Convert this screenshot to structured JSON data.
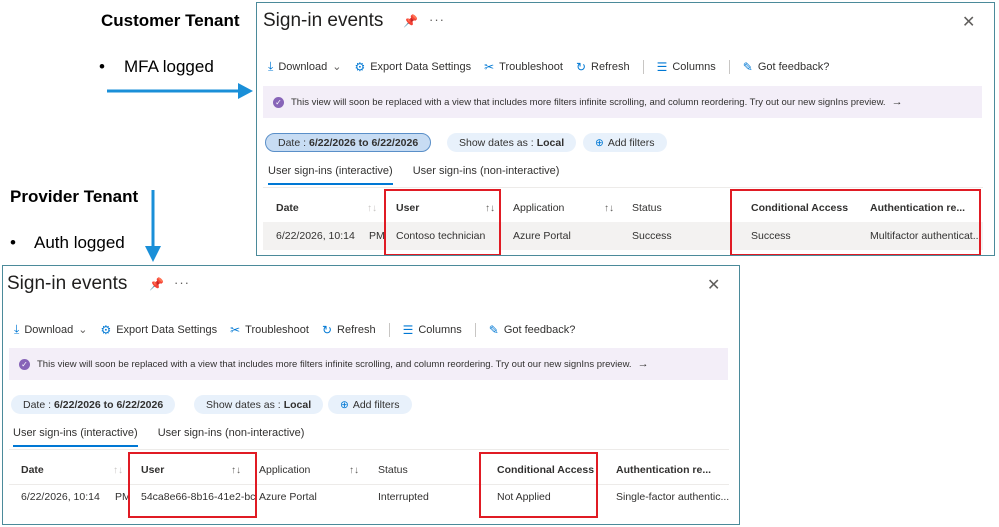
{
  "labels": {
    "customer_tenant": "Customer Tenant",
    "customer_bullet": "MFA logged",
    "provider_tenant": "Provider Tenant",
    "provider_bullet": "Auth logged",
    "bullet_glyph": "•"
  },
  "icons": {
    "pin": "pin-icon",
    "more": "more-icon",
    "close": "close-icon",
    "download": "download-icon",
    "export": "gear-icon",
    "troubleshoot": "wrench-icon",
    "refresh": "refresh-icon",
    "columns": "columns-icon",
    "feedback": "feedback-icon"
  },
  "colors": {
    "accent": "#0078d4",
    "highlight": "#e01b24",
    "arrow": "#1a8fd8",
    "banner": "#f3eef8"
  },
  "common": {
    "title": "Sign-in events",
    "more_glyph": "···",
    "close_glyph": "✕",
    "toolbar": {
      "download": "Download",
      "export": "Export Data Settings",
      "troubleshoot": "Troubleshoot",
      "refresh": "Refresh",
      "columns": "Columns",
      "feedback": "Got feedback?"
    },
    "banner_text": "This view will soon be replaced with a view that includes more filters infinite scrolling, and column reordering. Try out our new signIns preview.",
    "banner_arrow": "→",
    "filters": {
      "date_label": "Date :",
      "date_value": "6/22/2026 to 6/22/2026",
      "show_dates_label": "Show dates as :",
      "show_dates_value": "Local",
      "add_filters": "Add filters"
    },
    "tabs": {
      "interactive": "User sign-ins (interactive)",
      "non_interactive": "User sign-ins (non-interactive)"
    },
    "columns": {
      "date": "Date",
      "user": "User",
      "application": "Application",
      "status": "Status",
      "conditional_access": "Conditional Access",
      "auth": "Authentication re..."
    },
    "sort_glyph": "↑↓"
  },
  "customer_row": {
    "date": "6/22/2026, 10:14",
    "pm": "PM",
    "user": "Contoso technician",
    "application": "Azure Portal",
    "status": "Success",
    "conditional_access": "Success",
    "auth": "Multifactor authenticat..."
  },
  "provider_row": {
    "date": "6/22/2026, 10:14",
    "pm": "PM",
    "user": "54ca8e66-8b16-41e2-bc",
    "application": "Azure Portal",
    "status": "Interrupted",
    "conditional_access": "Not Applied",
    "auth": "Single-factor authentic..."
  }
}
